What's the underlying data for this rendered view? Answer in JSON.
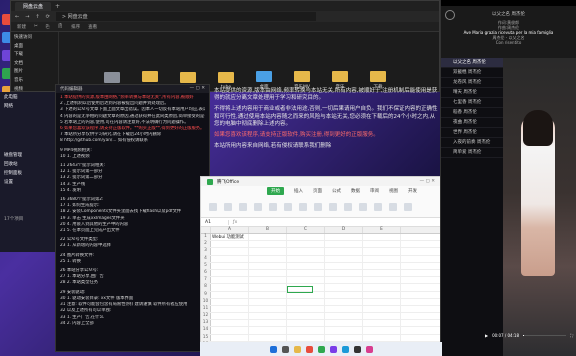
{
  "explorer": {
    "tab": "网盘云盘",
    "address": "> 网盘云盘",
    "toolbar": [
      "新建",
      "剪切",
      "复制",
      "粘贴",
      "排序",
      "查看"
    ],
    "sidebar": [
      "快速访问",
      "桌面",
      "下载",
      "文档",
      "图片",
      "音乐",
      "视频",
      "OneDrive",
      "此电脑"
    ],
    "files": [
      "mob.mkv",
      "webm视频",
      "rapper",
      "tube",
      "桌面",
      "音乐MV",
      "音乐",
      "下载"
    ]
  },
  "side2": [
    "此电脑",
    "网络",
    "磁盘管理",
    "回收站",
    "控制面板",
    "设置",
    "17个项目"
  ],
  "notepad": {
    "title": "代码编辑器",
    "lines": [
      "1  本站提供的资源,版本由网络,\"频率转换与本站无关\",所有内容,被顺好",
      "2  ,上述机制以后使用后达到内容被提出问题并到处理后。",
      "3  下述的公众号文章下面上面文章出错误。因本人一切反有本站用户均应,表达7天",
      "4  内容的是无争相的问题文章的原因,通过获得并在此同类原因,简单接受的是书原",
      "5  若本站上的内容,使用,可在内容请注意好,不法明确行为问题操作。",
      "6  如果您喜欢该程序,请支持正版软件。**购买正版**,得到更好的正版服务。",
      "7  本站所分享仅供学习研究,请在下载后24小时内删除",
      "8  http://github.com/yan/... 如有侵权请联系",
      "",
      "9  MP4视频相关:",
      "10   1. 上述视频",
      "",
      "11 2643个提示词相关:",
      "12   1. 提示词第一部分",
      "13   2. 提示词第二部分",
      "14   3. 生产线",
      "15   4. 发明",
      "",
      "16 3680个提示词第2:",
      "17   1. 如何生成提示:",
      "18   2. 安装Components文件夹里面去找下载flash以及pdf文件",
      "19   3. 单击 生成xxImages文件夹",
      "20   4. 用嵌入到其他的生产中的内容",
      "21   5. 在本页面上完成产出文件",
      "",
      "22 公众号文件类型:",
      "23   1. 从新增的内容中选择",
      "",
      "24 图片转换文件:",
      "25   1. 转换",
      "",
      "26 本站分享公众号:",
      "27   1. 本站分享,由广告",
      "28   2. 本站类型任务",
      "",
      "29 安装驱动:",
      "30   1. 驱动安装目录: xx文件 版本界面",
      "31   注意: 软件可能会包含有局限性(例) 建请谨慎 软件所有者应使用",
      "32   以及上述所有可以单独:",
      "33   1. 生产广告,在什么",
      "34   2. 内容上全部"
    ]
  },
  "article": {
    "p1": "本站提供的资源,版本由网络,频率转换与本站无关,所有内容,被顺好于,注册机制后能使用是获得的就应分离文章处理用于学习和研究目的。",
    "p2": "不得将上述内容用于商业或者非法用途,否则,一切后果请用户自负。我们不保证内容的正确性和可行性,通过使用本站内容随之而来的风险与本站无关,您必须在下载后的24个小时之内,从您的电脑中彻底删除上述内容。",
    "p3": "如果您喜欢该程序,请支持正版软件,购买注册,得到更好的正版服务。",
    "p4": "本站所用内容来自网络,若有侵权请联系我们删除"
  },
  "sheet": {
    "title": "腾飞Office",
    "tabs": [
      "开始",
      "插入",
      "页面",
      "公式",
      "数据",
      "审阅",
      "视图",
      "开发"
    ],
    "active_tab": "开始",
    "cell_ref": "A1",
    "columns": [
      "A",
      "B",
      "C",
      "D",
      "E"
    ],
    "a1": "Webui 功能测试",
    "rows": [
      "1",
      "2",
      "3",
      "4",
      "5",
      "6",
      "7",
      "8",
      "9",
      "10",
      "11",
      "12",
      "13",
      "14",
      "15",
      "16"
    ]
  },
  "player": {
    "window_title": "以父之名 周杰伦",
    "lyrics": [
      "作词:黄俊郎",
      "作曲:周杰伦",
      "Ave Maria grazia ricevuta per la mia famiglia",
      "周杰伦 - 以父之名",
      "Con risentito"
    ],
    "list": [
      "以父之名 周杰伦",
      "双截棍 周杰伦",
      "龙卷风 周杰伦",
      "晴天 周杰伦",
      "七里香 周杰伦",
      "稻香 周杰伦",
      "夜曲 周杰伦",
      "世界 周杰伦",
      "入夜的前奏 周杰伦",
      "简单爱 周杰伦"
    ],
    "selected": 0,
    "time": "00:07 / 04:18",
    "progress": 0.03
  },
  "colors": {
    "desktop_bg": "#3a2a8a",
    "sheet_accent": "#2fa84f",
    "highlight": "#ff4d4d"
  }
}
